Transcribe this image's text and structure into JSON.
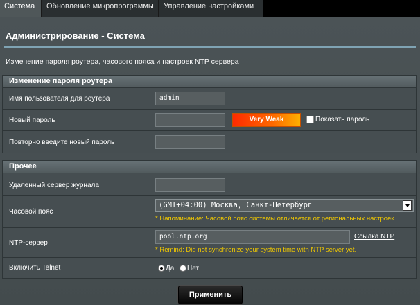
{
  "tabs": [
    {
      "label": "Система",
      "active": true
    },
    {
      "label": "Обновление микропрограммы",
      "active": false
    },
    {
      "label": "Управление настройками",
      "active": false
    }
  ],
  "page": {
    "title": "Администрирование - Система",
    "description": "Изменение пароля роутера, часового пояса и настроек NTP сервера"
  },
  "password_section": {
    "heading": "Изменение пароля роутера",
    "username_label": "Имя пользователя для роутера",
    "username_value": "admin",
    "new_password_label": "Новый пароль",
    "new_password_value": "",
    "strength_label": "Very Weak",
    "show_password_label": "Показать пароль",
    "show_password_checked": false,
    "confirm_label": "Повторно введите новый пароль",
    "confirm_value": ""
  },
  "misc_section": {
    "heading": "Прочее",
    "log_server_label": "Удаленный сервер журнала",
    "log_server_value": "",
    "timezone_label": "Часовой пояс",
    "timezone_value": "(GMT+04:00) Москва, Санкт-Петербург",
    "timezone_note": "* Напоминание: Часовой пояс системы отличается от региональных настроек.",
    "ntp_label": "NTP-сервер",
    "ntp_value": "pool.ntp.org",
    "ntp_link": "Ссылка NTP",
    "ntp_note": "* Remind: Did not synchronize your system time with NTP server yet.",
    "telnet_label": "Включить Telnet",
    "telnet_yes": "Да",
    "telnet_no": "Нет",
    "telnet_selected": "yes"
  },
  "apply_label": "Применить",
  "colors": {
    "accent_rule": "#7fa3b3",
    "note_text": "#f0c800",
    "strength_weak": "#ff2a00"
  }
}
